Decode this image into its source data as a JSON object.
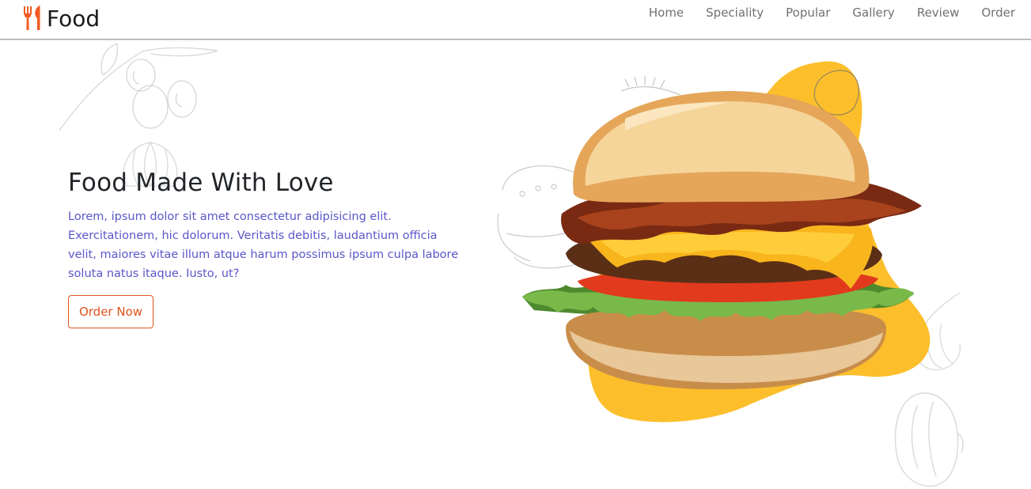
{
  "brand": {
    "name": "Food",
    "icon": "fork-spoon-icon",
    "icon_color": "#f15a22"
  },
  "nav": {
    "links": [
      "Home",
      "Speciality",
      "Popular",
      "Gallery",
      "Review",
      "Order"
    ]
  },
  "hero": {
    "title": "Food Made With Love",
    "text": "Lorem, ipsum dolor sit amet consectetur adipisicing elit. Exercitationem, hic dolorum. Veritatis debitis, laudantium officia velit, maiores vitae illum atque harum possimus ipsum culpa labore soluta natus itaque. Iusto, ut?",
    "button_label": "Order Now",
    "image": "burger-image"
  },
  "colors": {
    "accent": "#e0531d",
    "text_purple": "#5a56c9",
    "blob_yellow": "#fcbf2b"
  }
}
